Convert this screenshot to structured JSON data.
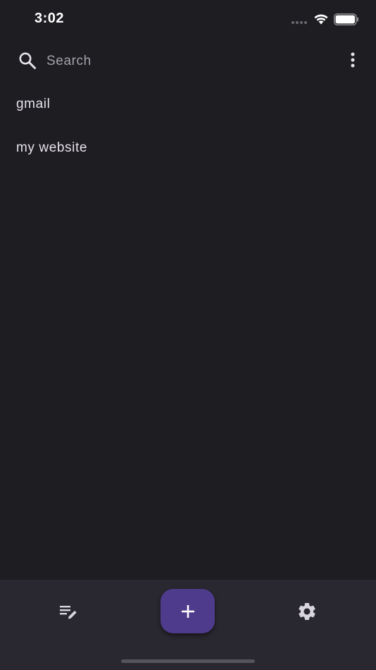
{
  "status_bar": {
    "time": "3:02"
  },
  "search": {
    "placeholder": "Search",
    "value": ""
  },
  "entries": [
    {
      "label": "gmail"
    },
    {
      "label": "my website"
    }
  ],
  "bottom_nav": {
    "left_icon": "edit-list-icon",
    "fab_icon": "plus-icon",
    "right_icon": "gear-icon"
  },
  "colors": {
    "background": "#1e1d22",
    "bottom_bar": "#29272f",
    "fab": "#4e3b8c",
    "text": "#e6e3ea"
  }
}
